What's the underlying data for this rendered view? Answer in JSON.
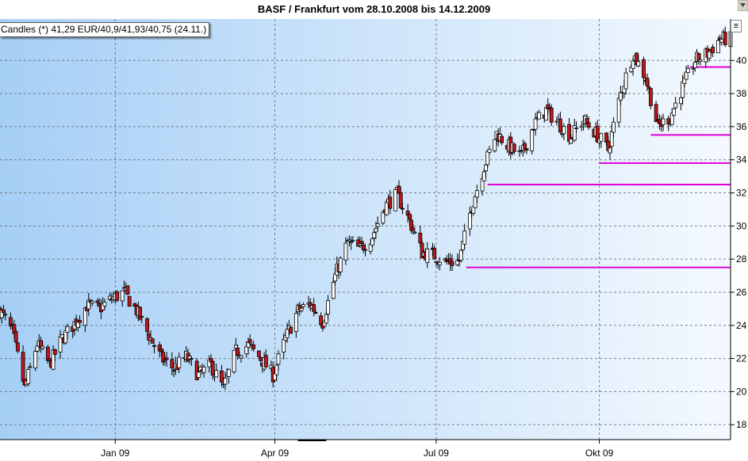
{
  "window": {
    "title": "BASF / Frankfurt vom 28.10.2008 bis 14.12.2009",
    "legend_text": "Candles (*) 41,29 EUR/40,9/41,93/40,75 (24.11.)",
    "menu_icon": "menu-lines-icon"
  },
  "colors": {
    "background_left": "#a6cff6",
    "background_right": "#f4f9fe",
    "up_candle": "#ffffff",
    "down_candle": "#c0171b",
    "wick": "#000000",
    "support_line": "#e000d8",
    "grid": "#555555"
  },
  "chart_data": {
    "type": "candlestick",
    "title": "BASF / Frankfurt vom 28.10.2008 bis 14.12.2009",
    "xlabel": "",
    "ylabel": "",
    "currency": "EUR",
    "x_ticks": [
      "Jan 09",
      "Apr 09",
      "Jul 09",
      "Okt 09"
    ],
    "x_tick_dates": [
      "2009-01-01",
      "2009-04-01",
      "2009-07-01",
      "2009-10-01"
    ],
    "xlim": [
      "2008-10-28",
      "2009-12-14"
    ],
    "y_ticks": [
      18,
      20,
      22,
      24,
      26,
      28,
      30,
      32,
      34,
      36,
      38,
      40
    ],
    "ylim": [
      17.1,
      42.5
    ],
    "grid": true,
    "legend": "Candles (*) 41,29 EUR/40,9/41,93/40,75 (24.11.)",
    "legend_position": "top-left",
    "close_series": [
      [
        "2008-10-28",
        24.9
      ],
      [
        "2008-11-04",
        23.6
      ],
      [
        "2008-11-11",
        20.2
      ],
      [
        "2008-11-18",
        22.9
      ],
      [
        "2008-11-25",
        21.6
      ],
      [
        "2008-12-02",
        23.2
      ],
      [
        "2008-12-09",
        24.1
      ],
      [
        "2008-12-16",
        25.2
      ],
      [
        "2008-12-23",
        25.0
      ],
      [
        "2008-12-30",
        25.6
      ],
      [
        "2009-01-06",
        26.0
      ],
      [
        "2009-01-13",
        24.9
      ],
      [
        "2009-01-20",
        23.4
      ],
      [
        "2009-01-27",
        22.0
      ],
      [
        "2009-02-03",
        21.4
      ],
      [
        "2009-02-10",
        22.1
      ],
      [
        "2009-02-17",
        21.0
      ],
      [
        "2009-02-24",
        21.6
      ],
      [
        "2009-03-03",
        20.2
      ],
      [
        "2009-03-10",
        22.4
      ],
      [
        "2009-03-17",
        22.8
      ],
      [
        "2009-03-24",
        22.0
      ],
      [
        "2009-03-31",
        21.0
      ],
      [
        "2009-04-07",
        23.2
      ],
      [
        "2009-04-14",
        24.9
      ],
      [
        "2009-04-21",
        25.3
      ],
      [
        "2009-04-28",
        24.2
      ],
      [
        "2009-05-05",
        27.0
      ],
      [
        "2009-05-12",
        29.0
      ],
      [
        "2009-05-19",
        28.6
      ],
      [
        "2009-05-26",
        29.4
      ],
      [
        "2009-06-02",
        31.2
      ],
      [
        "2009-06-09",
        31.9
      ],
      [
        "2009-06-16",
        30.3
      ],
      [
        "2009-06-23",
        28.4
      ],
      [
        "2009-06-30",
        28.2
      ],
      [
        "2009-07-07",
        27.8
      ],
      [
        "2009-07-14",
        27.9
      ],
      [
        "2009-07-21",
        31.2
      ],
      [
        "2009-07-28",
        33.6
      ],
      [
        "2009-08-04",
        35.6
      ],
      [
        "2009-08-11",
        34.8
      ],
      [
        "2009-08-18",
        34.2
      ],
      [
        "2009-08-25",
        36.1
      ],
      [
        "2009-09-01",
        37.0
      ],
      [
        "2009-09-08",
        36.2
      ],
      [
        "2009-09-15",
        35.4
      ],
      [
        "2009-09-22",
        36.4
      ],
      [
        "2009-09-29",
        35.6
      ],
      [
        "2009-10-06",
        34.6
      ],
      [
        "2009-10-13",
        38.0
      ],
      [
        "2009-10-20",
        40.4
      ],
      [
        "2009-10-27",
        39.0
      ],
      [
        "2009-11-03",
        36.0
      ],
      [
        "2009-11-10",
        36.6
      ],
      [
        "2009-11-17",
        38.4
      ],
      [
        "2009-11-24",
        40.0
      ],
      [
        "2009-12-01",
        40.4
      ],
      [
        "2009-12-08",
        41.3
      ],
      [
        "2009-12-14",
        41.3
      ]
    ],
    "support_lines": [
      {
        "start": "2009-07-18",
        "end": "2009-12-14",
        "level": 27.5
      },
      {
        "start": "2009-07-30",
        "end": "2009-12-14",
        "level": 32.5
      },
      {
        "start": "2009-10-01",
        "end": "2009-12-14",
        "level": 33.8
      },
      {
        "start": "2009-10-30",
        "end": "2009-12-14",
        "level": 35.5
      },
      {
        "start": "2009-11-21",
        "end": "2009-12-14",
        "level": 39.6
      }
    ],
    "gap_segment": {
      "start": "2009-04-14",
      "end": "2009-04-30"
    }
  }
}
